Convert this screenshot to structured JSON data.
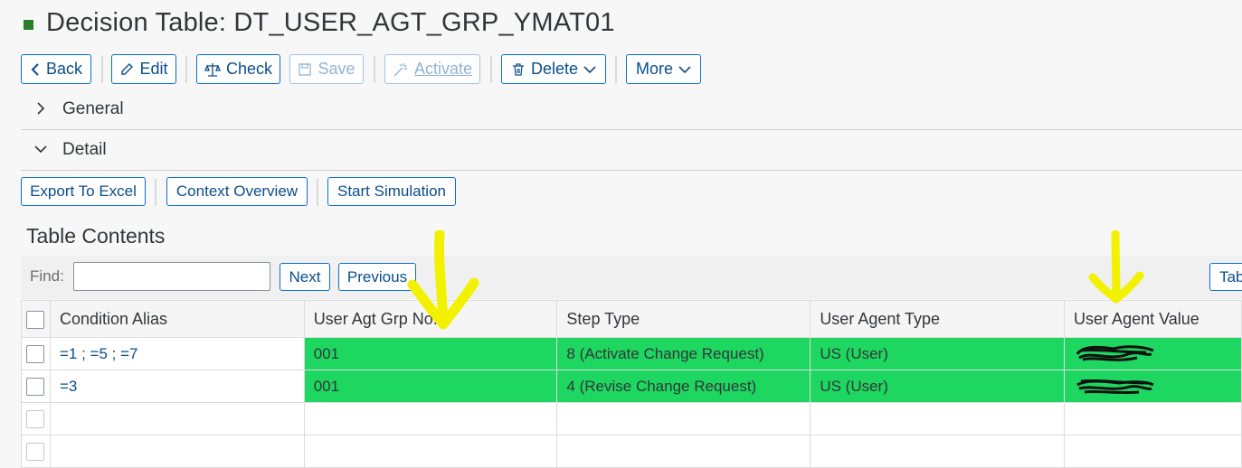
{
  "page": {
    "title": "Decision Table: DT_USER_AGT_GRP_YMAT01"
  },
  "toolbar": {
    "back": "Back",
    "edit": "Edit",
    "check": "Check",
    "save": "Save",
    "activate": "Activate",
    "delete": "Delete",
    "more": "More"
  },
  "sections": {
    "general": "General",
    "detail": "Detail"
  },
  "detail_toolbar": {
    "export": "Export To Excel",
    "context": "Context Overview",
    "simulation": "Start Simulation"
  },
  "table": {
    "title": "Table Contents",
    "find_label": "Find:",
    "find_value": "",
    "next": "Next",
    "previous": "Previous",
    "table_btn": "Table",
    "columns": [
      "Condition Alias",
      "User Agt Grp No.",
      "Step Type",
      "User Agent Type",
      "User Agent Value"
    ],
    "rows": [
      {
        "alias": "=1 ; =5 ; =7",
        "grp": "001",
        "step": "8 (Activate Change Request)",
        "agent_type": "US (User)",
        "agent_value": ""
      },
      {
        "alias": "=3",
        "grp": "001",
        "step": "4 (Revise Change Request)",
        "agent_type": "US (User)",
        "agent_value": ""
      }
    ],
    "highlight_color": "#1ed760"
  },
  "annotations": {
    "arrow_color": "#f2f200",
    "redaction_color": "#111111"
  }
}
